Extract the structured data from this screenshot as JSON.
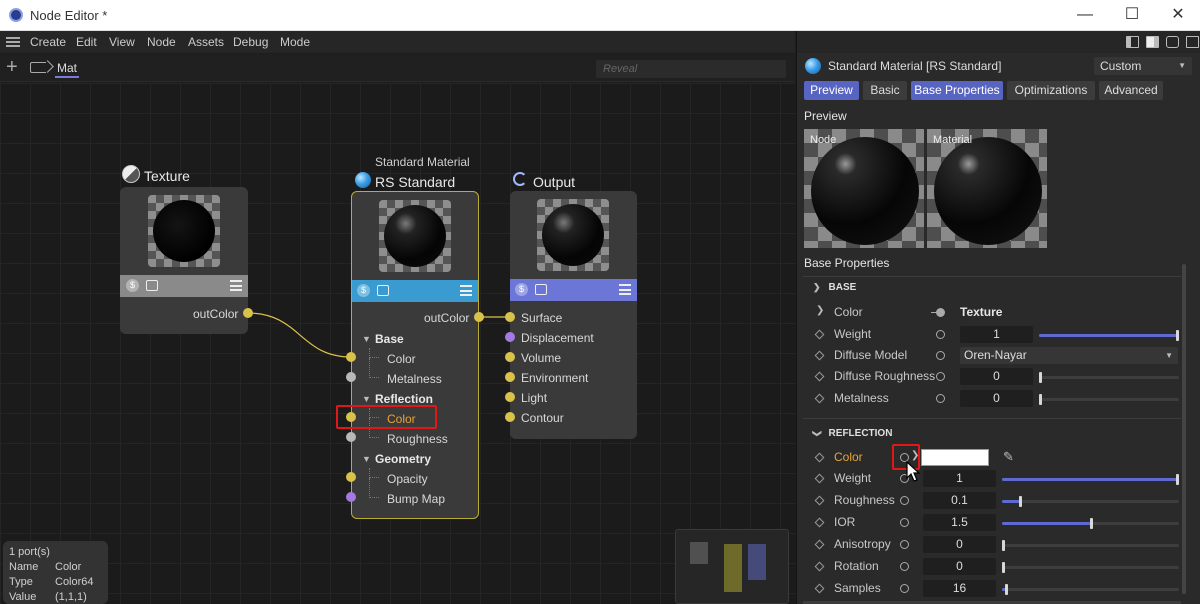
{
  "window": {
    "title": "Node Editor *",
    "minimize": "—",
    "maximize": "☐",
    "close": "✕"
  },
  "menu": [
    "Create",
    "Edit",
    "View",
    "Node",
    "Assets",
    "Debug",
    "Mode"
  ],
  "tabs": {
    "active": "Mat"
  },
  "search": {
    "placeholder": "Reveal"
  },
  "nodes": {
    "texture": {
      "title": "Texture",
      "output_port": "outColor"
    },
    "standard": {
      "subtitle": "Standard Material",
      "title": "RS Standard",
      "output_port": "outColor",
      "groups": [
        {
          "name": "Base",
          "ports": [
            "Color",
            "Metalness"
          ]
        },
        {
          "name": "Reflection",
          "ports": [
            "Color",
            "Roughness"
          ]
        },
        {
          "name": "Geometry",
          "ports": [
            "Opacity",
            "Bump Map"
          ]
        }
      ]
    },
    "output": {
      "title": "Output",
      "ports": [
        "Surface",
        "Displacement",
        "Volume",
        "Environment",
        "Light",
        "Contour"
      ]
    }
  },
  "info": {
    "count": "1 port(s)",
    "name_label": "Name",
    "name": "Color",
    "type_label": "Type",
    "type": "Color64",
    "value_label": "Value",
    "value": "(1,1,1)"
  },
  "panel": {
    "title": "Standard Material [RS Standard]",
    "preset": "Custom",
    "tabs": [
      "Preview",
      "Basic",
      "Base Properties",
      "Optimizations",
      "Advanced"
    ],
    "preview_heading": "Preview",
    "preview_node_label": "Node",
    "preview_material_label": "Material",
    "section_heading": "Base Properties",
    "base": {
      "label": "BASE",
      "color_label": "Color",
      "color_value": "Texture",
      "weight_label": "Weight",
      "weight_value": "1",
      "weight_level": 1.0,
      "diffuse_model_label": "Diffuse Model",
      "diffuse_model_value": "Oren-Nayar",
      "diffuse_rough_label": "Diffuse Roughness",
      "diffuse_rough_value": "0",
      "diffuse_rough_level": 0,
      "metalness_label": "Metalness",
      "metalness_value": "0",
      "metalness_level": 0
    },
    "reflection": {
      "label": "REFLECTION",
      "color_label": "Color",
      "color_swatch": "#ffffff",
      "weight_label": "Weight",
      "weight_value": "1",
      "weight_level": 1.0,
      "roughness_label": "Roughness",
      "roughness_value": "0.1",
      "roughness_level": 0.1,
      "ior_label": "IOR",
      "ior_value": "1.5",
      "ior_level": 0.5,
      "aniso_label": "Anisotropy",
      "aniso_value": "0",
      "aniso_level": 0,
      "rotation_label": "Rotation",
      "rotation_value": "0",
      "rotation_level": 0,
      "samples_label": "Samples",
      "samples_value": "16",
      "samples_level": 0.02
    }
  },
  "colors": {
    "accent": "#5864c2",
    "highlight": "#e01818",
    "port_yellow": "#d9c24a",
    "port_purple": "#a47ae0",
    "node_blue": "#3a9bd0",
    "output_blue": "#6b76d6",
    "selected_orange": "#e8a338"
  }
}
